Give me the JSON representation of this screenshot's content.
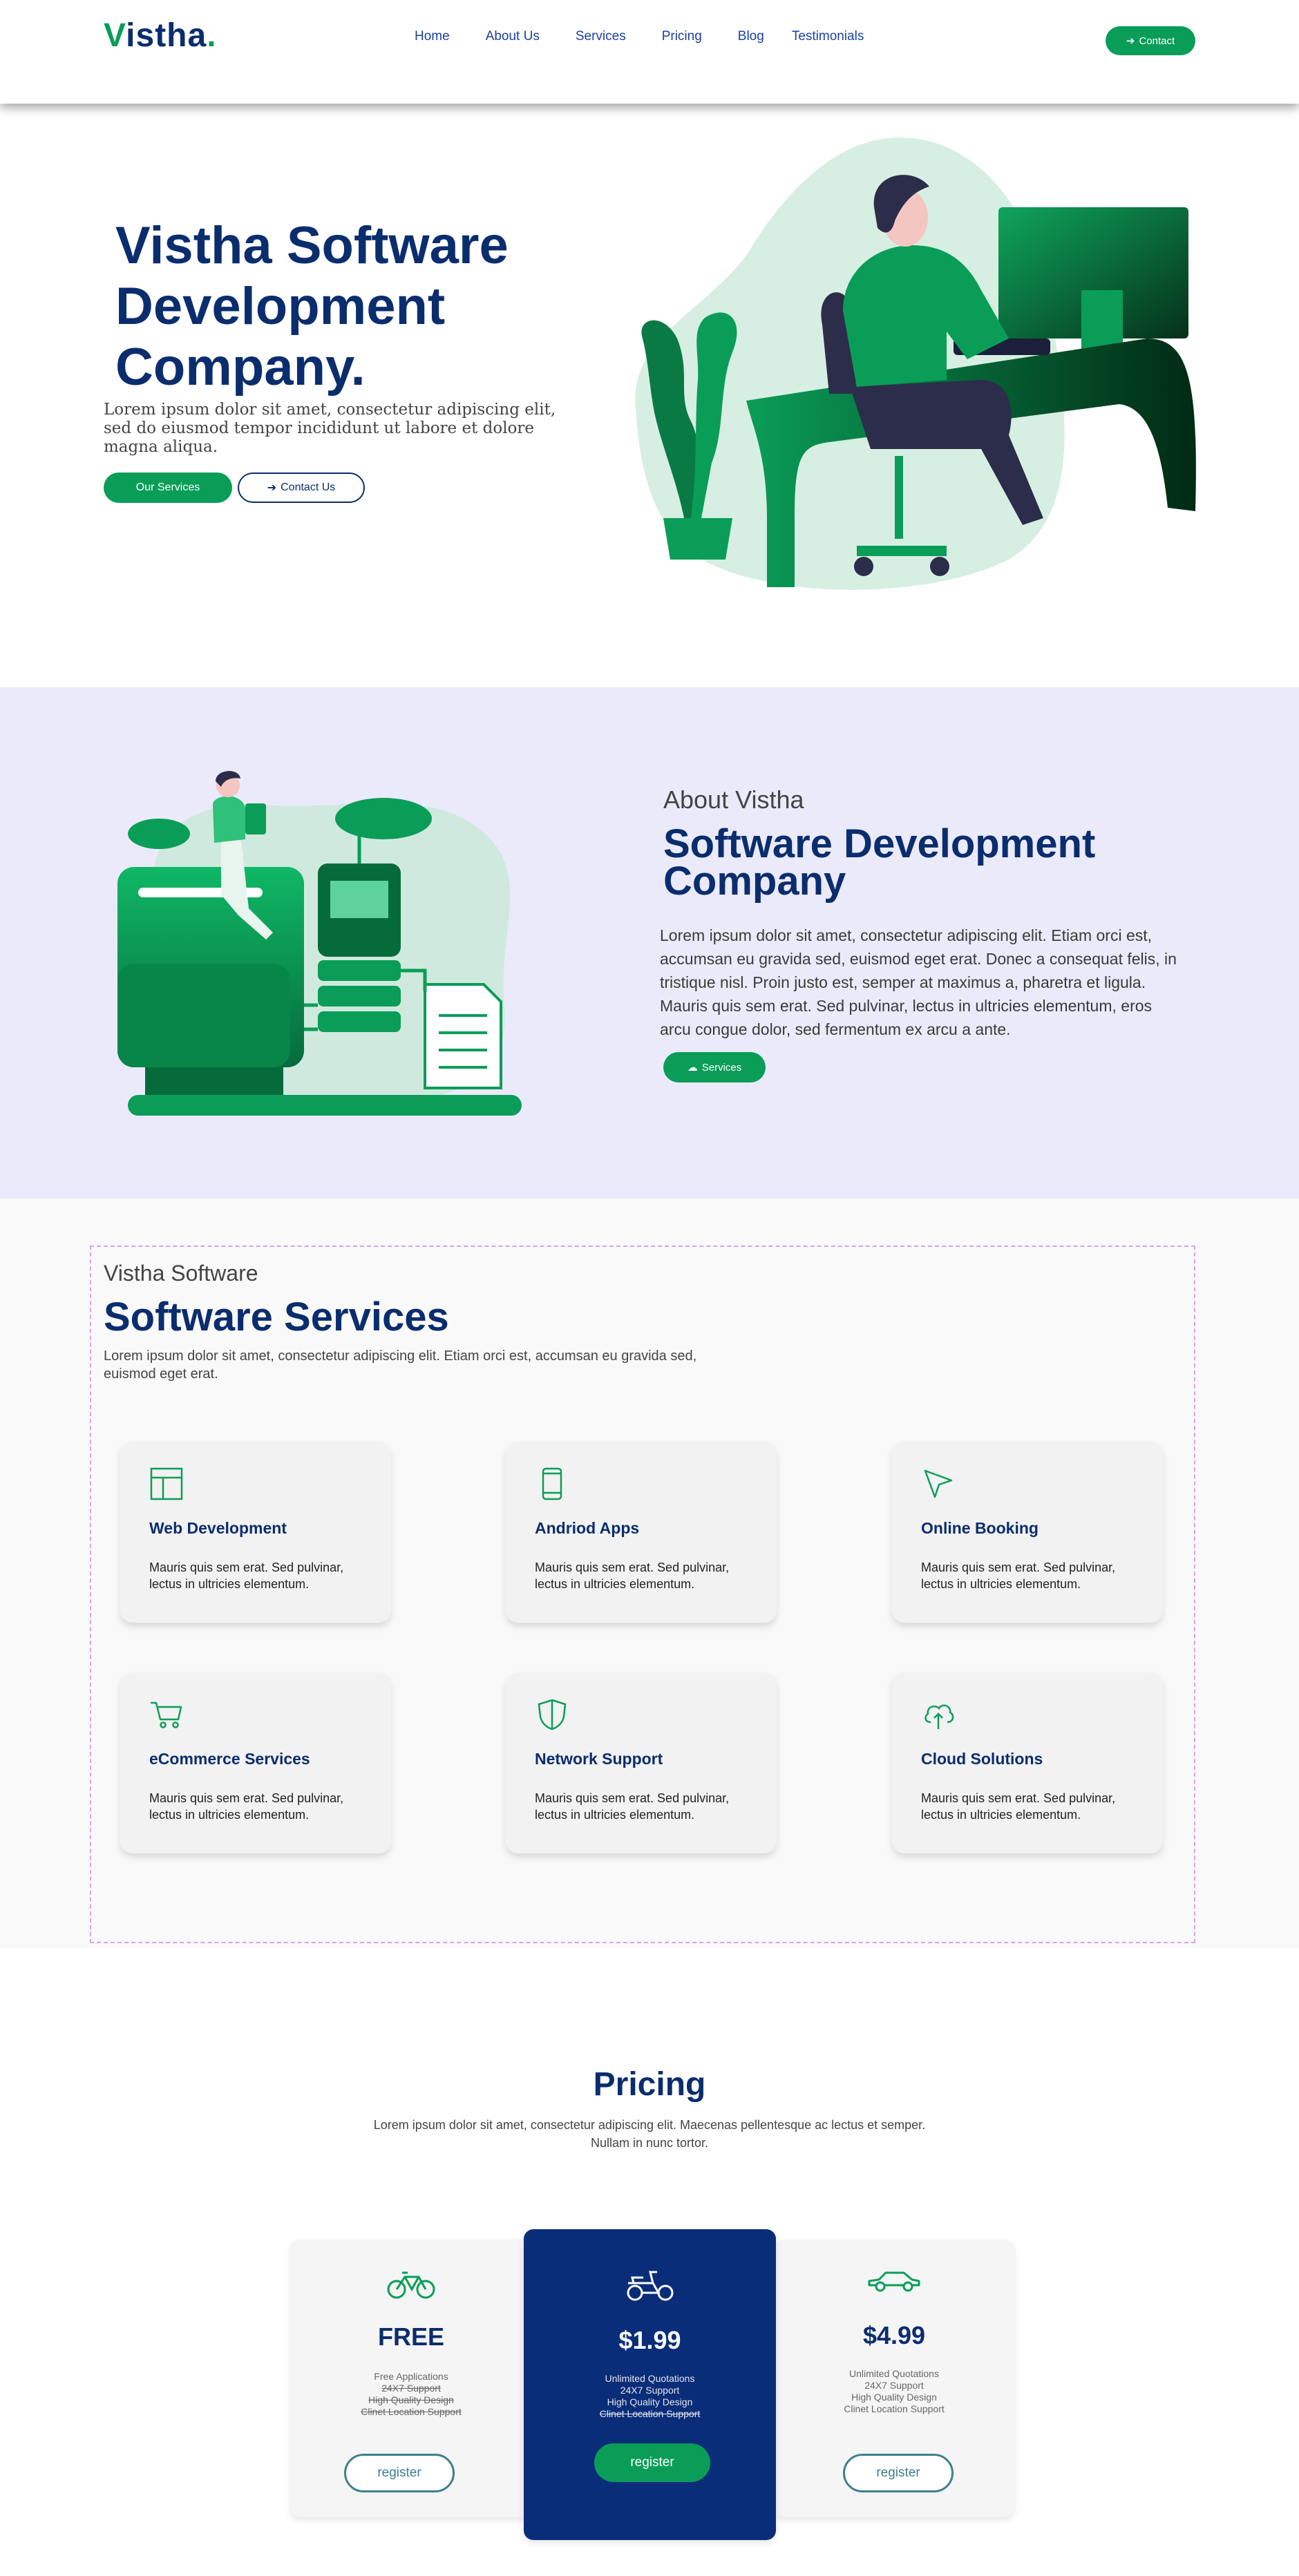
{
  "header": {
    "logo": {
      "v": "V",
      "rest": "istha",
      "dot": "."
    },
    "nav": [
      "Home",
      "About Us",
      "Services",
      "Pricing",
      "Blog",
      "Testimonials"
    ],
    "contact_label": "Contact"
  },
  "hero": {
    "title": "Vistha Software Development Company.",
    "text": "Lorem ipsum dolor sit amet, consectetur adipiscing elit, sed do eiusmod tempor incididunt ut labore et dolore magna aliqua.",
    "primary_button": "Our Services",
    "secondary_button": "Contact Us"
  },
  "about": {
    "kicker": "About Vistha",
    "title": "Software Development Company",
    "text": "Lorem ipsum dolor sit amet, consectetur adipiscing elit. Etiam orci est, accumsan eu gravida sed, euismod eget erat. Donec a consequat felis, in tristique nisl. Proin justo est, semper at maximus a, pharetra et ligula. Mauris quis sem erat. Sed pulvinar, lectus in ultricies elementum, eros arcu congue dolor, sed fermentum ex arcu a ante.",
    "button": "Services"
  },
  "services": {
    "kicker": "Vistha Software",
    "title": "Software Services",
    "intro": "Lorem ipsum dolor sit amet, consectetur adipiscing elit. Etiam orci est, accumsan eu gravida sed, euismod eget erat.",
    "cards": [
      {
        "title": "Web Development",
        "text": "Mauris quis sem erat. Sed pulvinar, lectus in ultricies elementum.",
        "icon": "layout-icon"
      },
      {
        "title": "Andriod Apps",
        "text": "Mauris quis sem erat. Sed pulvinar, lectus in ultricies elementum.",
        "icon": "phone-icon"
      },
      {
        "title": "Online Booking",
        "text": "Mauris quis sem erat. Sed pulvinar, lectus in ultricies elementum.",
        "icon": "cursor-icon"
      },
      {
        "title": "eCommerce Services",
        "text": "Mauris quis sem erat. Sed pulvinar, lectus in ultricies elementum.",
        "icon": "cart-icon"
      },
      {
        "title": "Network Support",
        "text": "Mauris quis sem erat. Sed pulvinar, lectus in ultricies elementum.",
        "icon": "shield-icon"
      },
      {
        "title": "Cloud Solutions",
        "text": "Mauris quis sem erat. Sed pulvinar, lectus in ultricies elementum.",
        "icon": "cloud-upload-icon"
      }
    ]
  },
  "pricing": {
    "title": "Pricing",
    "intro": "Lorem ipsum dolor sit amet, consectetur adipiscing elit. Maecenas pellentesque ac lectus et semper. Nullam in nunc tortor.",
    "plans": [
      {
        "price": "FREE",
        "icon": "bicycle-icon",
        "features": [
          "Free Applications",
          "24X7 Support",
          "High Quality Design",
          "Clinet Location Support"
        ],
        "register": "register"
      },
      {
        "price": "$1.99",
        "icon": "scooter-icon",
        "features": [
          "Unlimited Quotations",
          "24X7 Support",
          "High Quality Design",
          "Clinet Location Support"
        ],
        "register": "register"
      },
      {
        "price": "$4.99",
        "icon": "car-icon",
        "features": [
          "Unlimited Quotations",
          "24X7 Support",
          "High Quality Design",
          "Clinet Location Support"
        ],
        "register": "register"
      }
    ]
  },
  "colors": {
    "brand_green": "#0a9d58",
    "brand_navy": "#0a2d6e",
    "about_bg": "#ebeafb"
  }
}
